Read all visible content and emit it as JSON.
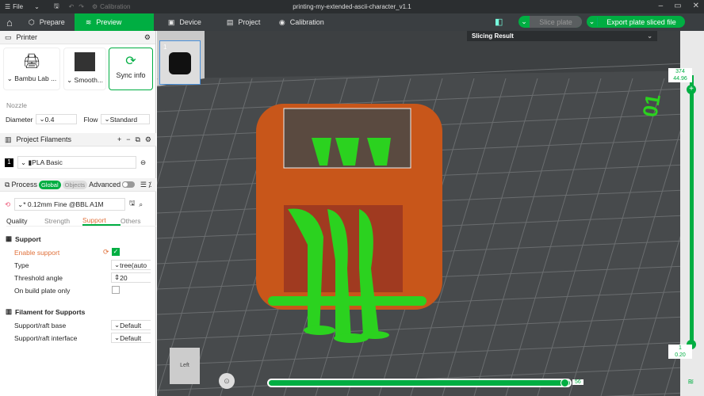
{
  "titlebar": {
    "menu": "File",
    "calibration": "Calibration",
    "title": "printing-my-extended-ascii-character_v1.1"
  },
  "tabs": [
    {
      "label": "Prepare"
    },
    {
      "label": "Preview"
    },
    {
      "label": "Device"
    },
    {
      "label": "Project"
    },
    {
      "label": "Calibration"
    }
  ],
  "toolbar": {
    "slice": "Slice plate",
    "export": "Export plate sliced file"
  },
  "printer": {
    "header": "Printer",
    "printer_name": "Bambu Lab ...",
    "plate": "Smooth...",
    "sync": "Sync info",
    "nozzle_label": "Nozzle",
    "diameter_label": "Diameter",
    "diameter": "0.4",
    "flow_label": "Flow",
    "flow": "Standard"
  },
  "filaments": {
    "header": "Project Filaments",
    "items": [
      {
        "index": "1",
        "name": "PLA Basic",
        "color": "#000000"
      }
    ]
  },
  "process": {
    "header": "Process",
    "global": "Global",
    "objects": "Objects",
    "advanced": "Advanced",
    "preset": "* 0.12mm Fine @BBL A1M",
    "tabs": [
      "Quality",
      "Strength",
      "Support",
      "Others"
    ],
    "support_header": "Support",
    "enable_support": "Enable support",
    "type_label": "Type",
    "type": "tree(auto",
    "threshold_label": "Threshold angle",
    "threshold": "20",
    "build_plate_label": "On build plate only",
    "fil_header": "Filament for Supports",
    "base_label": "Support/raft base",
    "base": "Default",
    "interface_label": "Support/raft interface",
    "interface": "Default"
  },
  "viewport": {
    "slicing_result": "Slicing Result",
    "plate_number": "1",
    "layer_top": "374",
    "height_top": "44.96",
    "layer_bottom": "1",
    "height_bottom": "0.20",
    "move_value": "56",
    "cube_face": "Left",
    "bed_label": "01"
  },
  "colors": {
    "accent": "#00ae42",
    "model": "#c8561a",
    "support": "#2bd21f"
  }
}
